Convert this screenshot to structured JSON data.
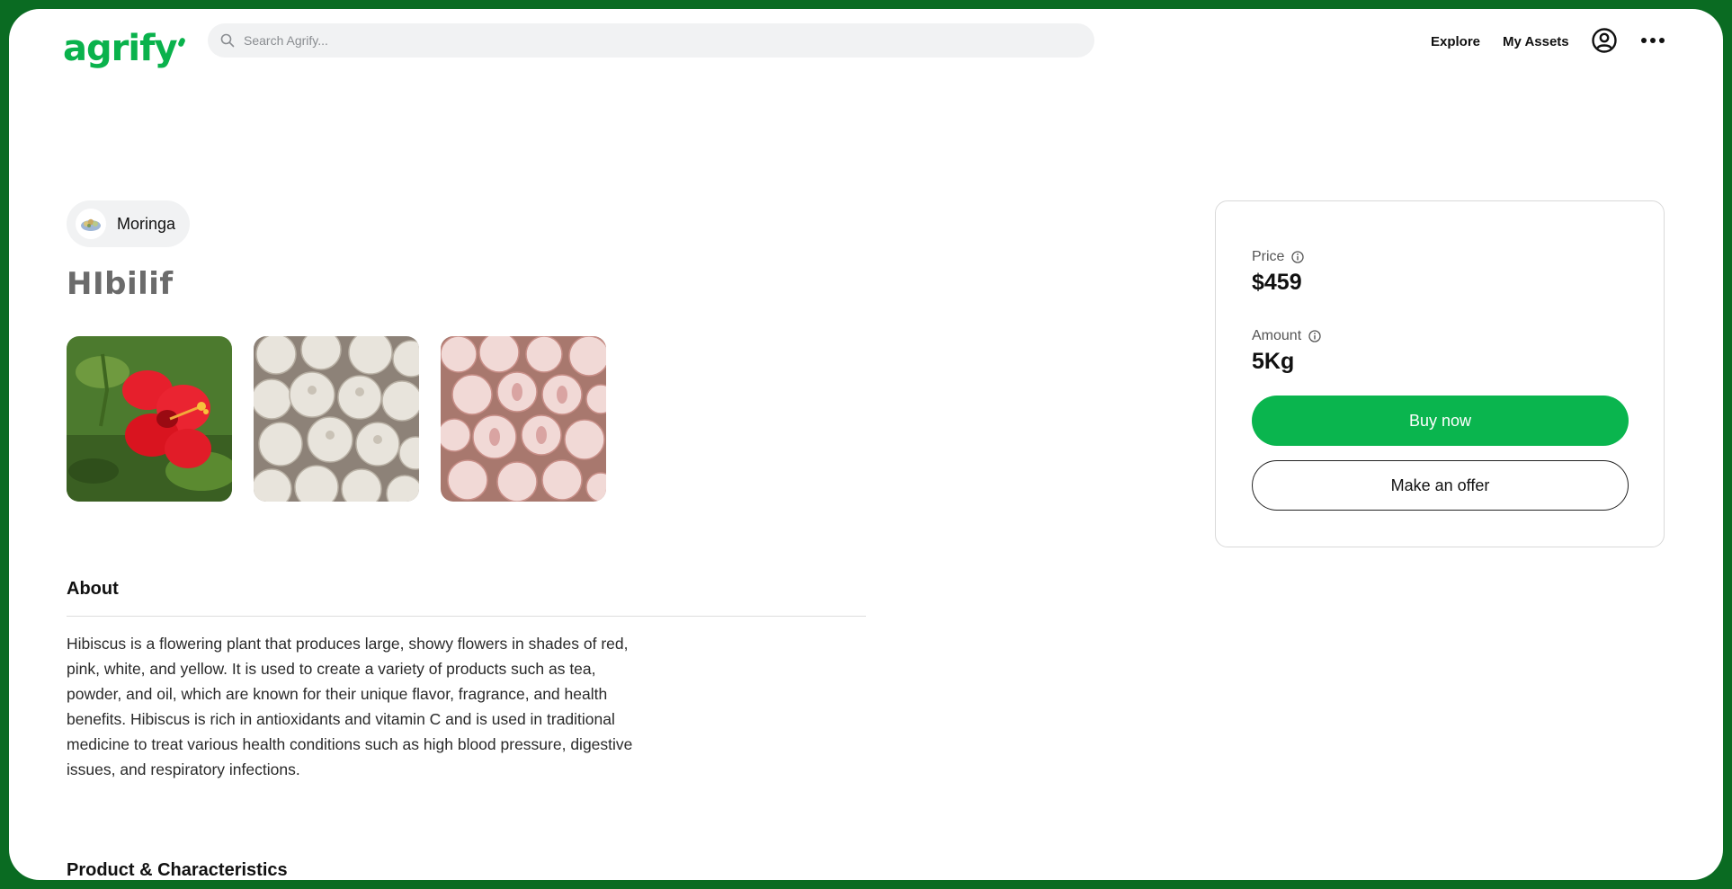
{
  "header": {
    "logo_text": "agrify",
    "search_placeholder": "Search Agrify...",
    "nav": {
      "explore": "Explore",
      "my_assets": "My Assets"
    },
    "icons": {
      "search": "search-icon",
      "profile": "user-circle-icon",
      "more": "more-horizontal-icon"
    }
  },
  "product": {
    "category": "Moringa",
    "title": "HIbilif",
    "images": [
      {
        "name": "hibiscus-flower-image"
      },
      {
        "name": "garlic-bulbs-image"
      },
      {
        "name": "pink-garlic-image"
      }
    ]
  },
  "about": {
    "heading": "About",
    "text": "Hibiscus is a flowering plant that produces large, showy flowers in shades of red, pink, white, and yellow. It is used to create a variety of products such as tea, powder, and oil, which are known for their unique flavor, fragrance, and health benefits. Hibiscus is rich in antioxidants and vitamin C and is used in traditional medicine to treat various health conditions such as high blood pressure, digestive issues, and respiratory infections."
  },
  "characteristics": {
    "heading": "Product & Characteristics"
  },
  "purchase": {
    "price_label": "Price",
    "price_value": "$459",
    "amount_label": "Amount",
    "amount_value": "5Kg",
    "buy_label": "Buy now",
    "offer_label": "Make an offer"
  },
  "colors": {
    "brand": "#0ab54e",
    "frame": "#0a6b22"
  }
}
